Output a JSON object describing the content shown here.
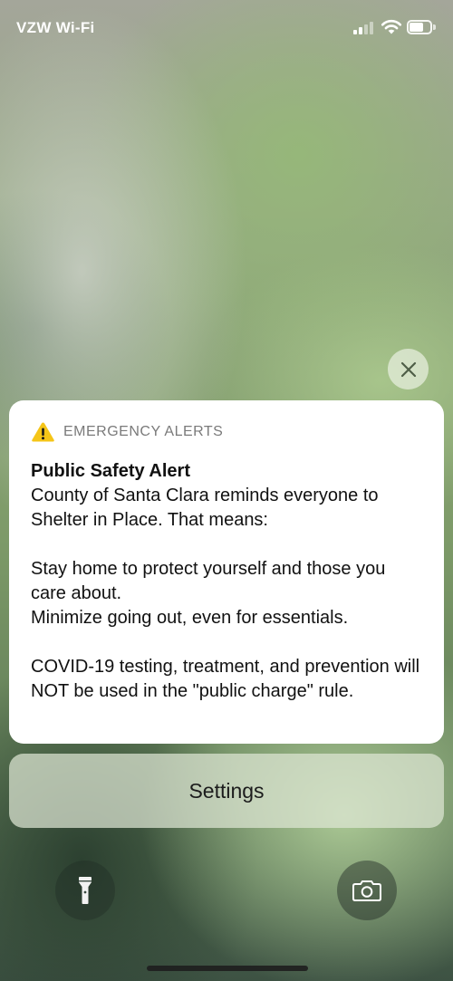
{
  "status_bar": {
    "carrier": "VZW Wi-Fi",
    "signal_bars_active": 2,
    "signal_bars_total": 4,
    "battery_level": 0.7
  },
  "dismiss": {
    "icon": "close-icon"
  },
  "notification": {
    "app_name": "EMERGENCY ALERTS",
    "icon": "warning-icon",
    "icon_color": "#f5c518",
    "title": "Public Safety Alert",
    "paragraphs": [
      [
        "County of Santa Clara reminds everyone to Shelter in Place. That means:"
      ],
      [
        "Stay home to protect yourself and those you care about.",
        "Minimize going out, even for essentials."
      ],
      [
        "COVID-19 testing, treatment, and prevention will NOT be used in the \"public charge\" rule."
      ]
    ]
  },
  "settings_button": {
    "label": "Settings"
  },
  "bottom_controls": {
    "left_icon": "flashlight-icon",
    "right_icon": "camera-icon"
  }
}
